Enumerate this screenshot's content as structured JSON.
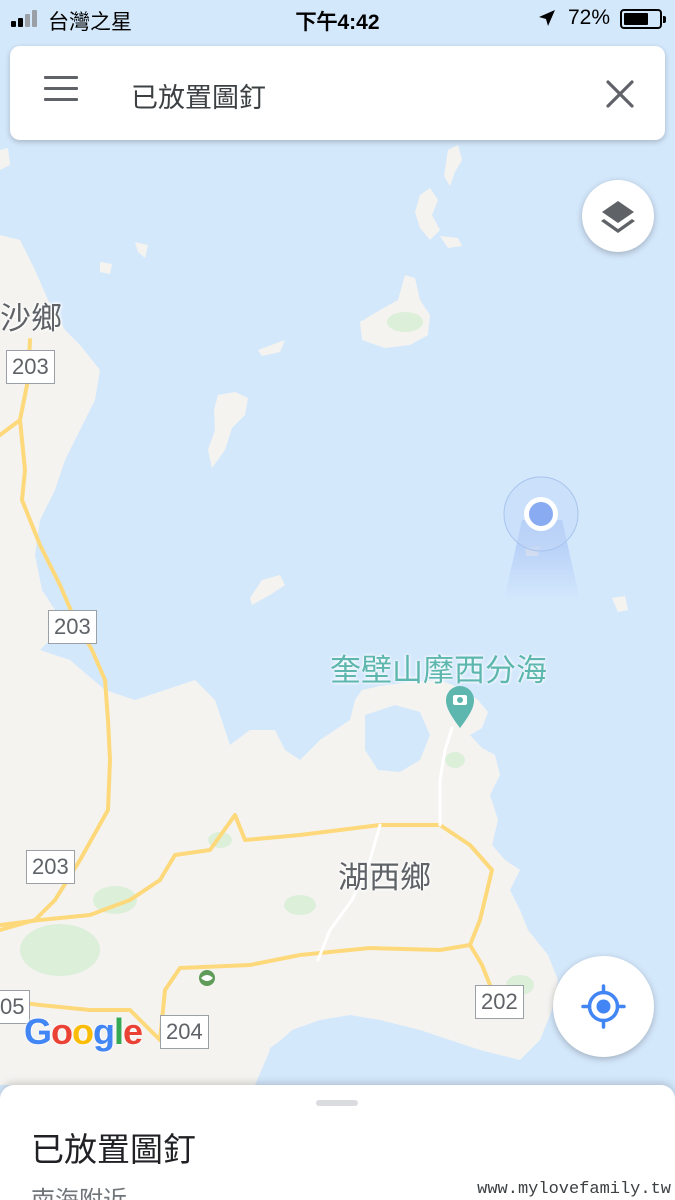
{
  "status_bar": {
    "carrier": "台灣之星",
    "time": "下午4:42",
    "battery_percent": "72%",
    "battery_level": 0.72,
    "signal_bars_filled": 2,
    "signal_bars_total": 4
  },
  "search_bar": {
    "query": "已放置圖釘",
    "menu_icon": "hamburger-menu-icon",
    "clear_icon": "close-icon"
  },
  "map": {
    "area_labels": {
      "top_left": "沙鄉",
      "huxi": "湖西鄉"
    },
    "poi": {
      "name": "奎壁山摩西分海",
      "icon": "camera-pin-icon"
    },
    "road_shields": [
      "203",
      "203",
      "203",
      "204",
      "202",
      "05"
    ],
    "brand": "Google",
    "colors": {
      "water": "#d4e8fc",
      "land": "#f4f3f0",
      "road": "#fdd97c",
      "park": "#dcefd9",
      "location_dot": "#89abf1",
      "poi_teal": "#5db7ae",
      "accent_blue": "#4285f4"
    }
  },
  "controls": {
    "layers_icon": "layers-icon",
    "my_location_icon": "my-location-crosshair-icon"
  },
  "bottom_sheet": {
    "title": "已放置圖釘",
    "subtitle": "南海附近"
  },
  "watermark": "www.mylovefamily.tw"
}
